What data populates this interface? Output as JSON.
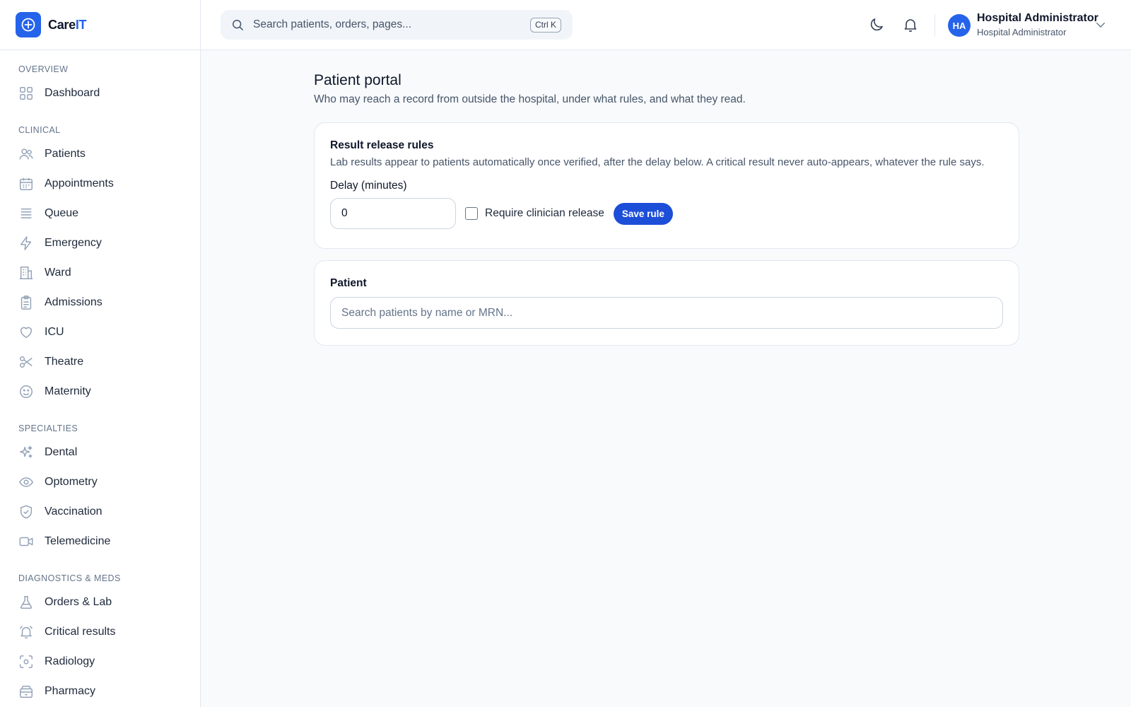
{
  "brand": {
    "name_prefix": "Care",
    "name_suffix": "IT",
    "accent_color": "#2563eb"
  },
  "search": {
    "placeholder": "Search patients, orders, pages...",
    "shortcut": "Ctrl K"
  },
  "header": {
    "icons": [
      "moon-icon",
      "bell-icon"
    ],
    "user": {
      "initials": "HA",
      "name": "Hospital Administrator",
      "role": "Hospital Administrator"
    }
  },
  "sidebar": {
    "sections": [
      {
        "title": "OVERVIEW",
        "items": [
          {
            "label": "Dashboard",
            "icon": "grid-icon"
          }
        ]
      },
      {
        "title": "CLINICAL",
        "items": [
          {
            "label": "Patients",
            "icon": "users-icon"
          },
          {
            "label": "Appointments",
            "icon": "calendar-icon"
          },
          {
            "label": "Queue",
            "icon": "list-icon"
          },
          {
            "label": "Emergency",
            "icon": "lightning-icon"
          },
          {
            "label": "Ward",
            "icon": "building-icon"
          },
          {
            "label": "Admissions",
            "icon": "clipboard-icon"
          },
          {
            "label": "ICU",
            "icon": "heart-icon"
          },
          {
            "label": "Theatre",
            "icon": "scissors-icon"
          },
          {
            "label": "Maternity",
            "icon": "smile-icon"
          }
        ]
      },
      {
        "title": "SPECIALTIES",
        "items": [
          {
            "label": "Dental",
            "icon": "sparkles-icon"
          },
          {
            "label": "Optometry",
            "icon": "eye-icon"
          },
          {
            "label": "Vaccination",
            "icon": "shield-icon"
          },
          {
            "label": "Telemedicine",
            "icon": "video-icon"
          }
        ]
      },
      {
        "title": "DIAGNOSTICS & MEDS",
        "items": [
          {
            "label": "Orders & Lab",
            "icon": "flask-icon"
          },
          {
            "label": "Critical results",
            "icon": "bell-alert-icon"
          },
          {
            "label": "Radiology",
            "icon": "scan-icon"
          },
          {
            "label": "Pharmacy",
            "icon": "pharmacy-icon"
          }
        ]
      }
    ]
  },
  "page": {
    "title": "Patient portal",
    "subtitle": "Who may reach a record from outside the hospital, under what rules, and what they read."
  },
  "release_rules": {
    "title": "Result release rules",
    "description": "Lab results appear to patients automatically once verified, after the delay below. A critical result never auto-appears, whatever the rule says.",
    "delay_label": "Delay (minutes)",
    "delay_value": "0",
    "require_release_label": "Require clinician release",
    "require_release_checked": false,
    "save_label": "Save rule"
  },
  "patient_lookup": {
    "label": "Patient",
    "placeholder": "Search patients by name or MRN..."
  }
}
